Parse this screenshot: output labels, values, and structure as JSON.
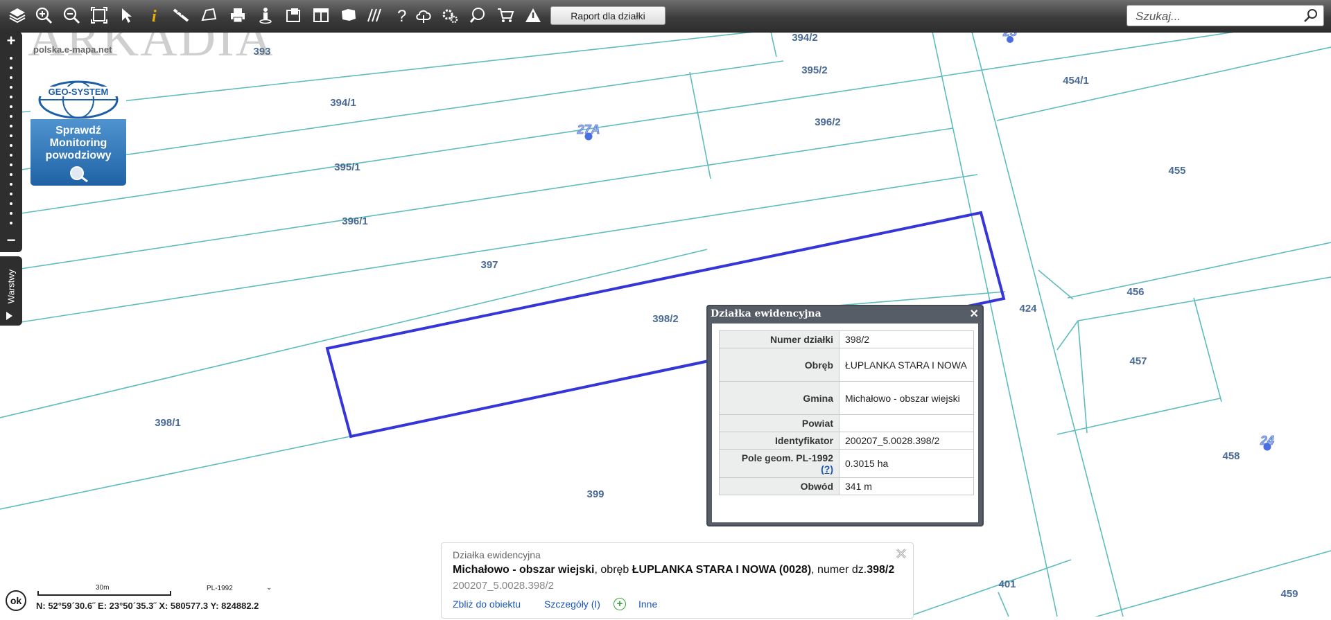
{
  "toolbar": {
    "icons": [
      "layers-icon",
      "zoom-in-icon",
      "zoom-out-icon",
      "zoom-extent-icon",
      "pointer-icon",
      "info-icon",
      "measure-distance-icon",
      "measure-area-icon",
      "print-icon",
      "street-view-icon",
      "overview-map-icon",
      "layout-icon",
      "map-shape-icon",
      "hatch-icon",
      "help-icon",
      "cloud-upload-icon",
      "settings-icon",
      "search-map-icon",
      "cart-icon",
      "warning-icon"
    ],
    "report_button": "Raport dla działki"
  },
  "search": {
    "placeholder": "Szukaj..."
  },
  "watermark": "ARKADIA",
  "logo": {
    "url": "polska.e-mapa.net",
    "brand": "GEO-SYSTEM",
    "line1": "Sprawdź",
    "line2": "Monitoring",
    "line3": "powodziowy"
  },
  "zoom": {
    "plus": "+",
    "minus": "−"
  },
  "layers_tab": {
    "label": "Warstwy"
  },
  "map": {
    "parcel_labels": [
      "393",
      "394/2",
      "395/2",
      "454/1",
      "394/1",
      "396/2",
      "395/1",
      "455",
      "396/1",
      "397",
      "456",
      "424",
      "398/2",
      "457",
      "398/1",
      "458",
      "399",
      "401",
      "459"
    ],
    "address_points": [
      "23",
      "27A",
      "24"
    ],
    "highlight_color": "#3535d8",
    "parcel_line_color": "#5fbcbc"
  },
  "popup": {
    "title": "Działka ewidencyjna",
    "rows": [
      {
        "k": "Numer działki",
        "v": "398/2"
      },
      {
        "k": "Obręb",
        "v": "ŁUPLANKA STARA I NOWA"
      },
      {
        "k": "Gmina",
        "v": "Michałowo - obszar wiejski"
      },
      {
        "k": "Powiat",
        "v": ""
      },
      {
        "k": "Identyfikator",
        "v": "200207_5.0028.398/2"
      },
      {
        "k": "Pole geom. PL-1992",
        "v": "0.3015 ha",
        "help": "(?)"
      },
      {
        "k": "Obwód",
        "v": "341 m"
      }
    ]
  },
  "info_panel": {
    "title": "Działka ewidencyjna",
    "gmina": "Michałowo - obszar wiejski",
    "obreb_prefix": ", obręb ",
    "obreb": "ŁUPLANKA STARA I NOWA (0028)",
    "numer_prefix": ", numer dz.",
    "numer": "398/2",
    "identifier": "200207_5.0028.398/2",
    "link_zoom": "Zbliż do obiektu",
    "link_details": "Szczegóły (I)",
    "link_other": "Inne"
  },
  "status": {
    "ok": "ok",
    "scale": "30m",
    "crs": "PL-1992",
    "coords": "N: 52°59´30.6˝ E: 23°50´35.3˝  X: 580577.3  Y: 824882.2"
  }
}
